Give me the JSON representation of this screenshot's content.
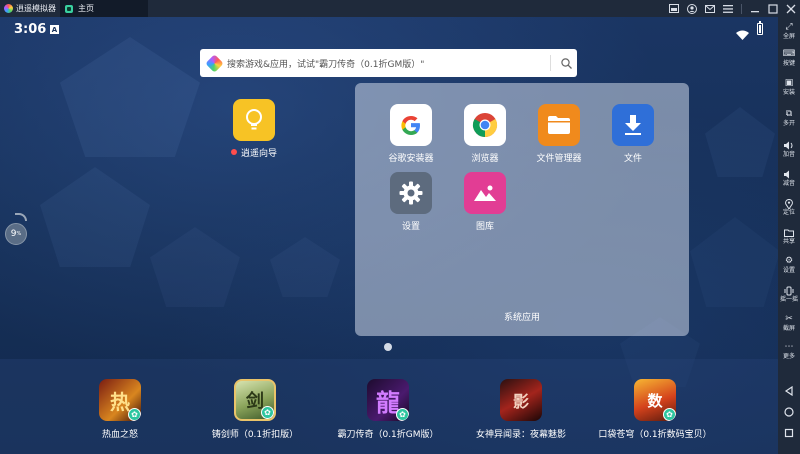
{
  "titlebar": {
    "app_name": "逍遥模拟器",
    "tab_label": "主页",
    "buttons": [
      "minimize-to-tray-icon",
      "user-icon",
      "mail-icon",
      "menu-icon",
      "minimize-icon",
      "maximize-icon",
      "close-icon"
    ]
  },
  "statusbar": {
    "time": "3:06",
    "notification_letter": "A"
  },
  "search": {
    "placeholder": "搜索游戏&应用，试试\"霸刀传奇（0.1折GM版）\""
  },
  "desktop": {
    "guide_label": "逍遥向导",
    "side_badge_value": "9",
    "side_badge_unit": "%"
  },
  "folder": {
    "title": "系统应用",
    "apps": [
      {
        "label": "谷歌安装器",
        "icon": "google-installer-icon"
      },
      {
        "label": "浏览器",
        "icon": "chrome-browser-icon"
      },
      {
        "label": "文件管理器",
        "icon": "file-manager-icon"
      },
      {
        "label": "文件",
        "icon": "download-files-icon"
      },
      {
        "label": "设置",
        "icon": "settings-gear-icon"
      },
      {
        "label": "图库",
        "icon": "gallery-icon"
      }
    ]
  },
  "dock": {
    "apps": [
      {
        "label": "热血之怒",
        "glyph": "热"
      },
      {
        "label": "铸剑师（0.1折扣版）",
        "glyph": "剑"
      },
      {
        "label": "霸刀传奇（0.1折GM版）",
        "glyph": "龍"
      },
      {
        "label": "女神异闻录：夜幕魅影",
        "glyph": "影"
      },
      {
        "label": "口袋苍穹（0.1折数码宝贝）",
        "glyph": "数"
      }
    ]
  },
  "toolbar": {
    "items": [
      {
        "label": "全屏",
        "glyph": "⤢"
      },
      {
        "label": "按键",
        "glyph": "⌨"
      },
      {
        "label": "安装",
        "glyph": "▣"
      },
      {
        "label": "多开",
        "glyph": "⧉"
      },
      {
        "label": "加音",
        "glyph": "🔊"
      },
      {
        "label": "减音",
        "glyph": "🔉"
      },
      {
        "label": "定位",
        "glyph": "⌾"
      },
      {
        "label": "共享",
        "glyph": "▭"
      },
      {
        "label": "设置",
        "glyph": "⚙"
      },
      {
        "label": "摇一摇",
        "glyph": "⟲"
      },
      {
        "label": "截屏",
        "glyph": "✂"
      },
      {
        "label": "更多",
        "glyph": "⋯"
      }
    ],
    "nav": [
      "back-icon",
      "home-icon",
      "recents-icon"
    ]
  },
  "colors": {
    "titlebar_bg": "#1f2a3b",
    "desktop_bg": "#163058",
    "accent_teal": "#2ec6a0",
    "guide_yellow": "#f7c325"
  }
}
